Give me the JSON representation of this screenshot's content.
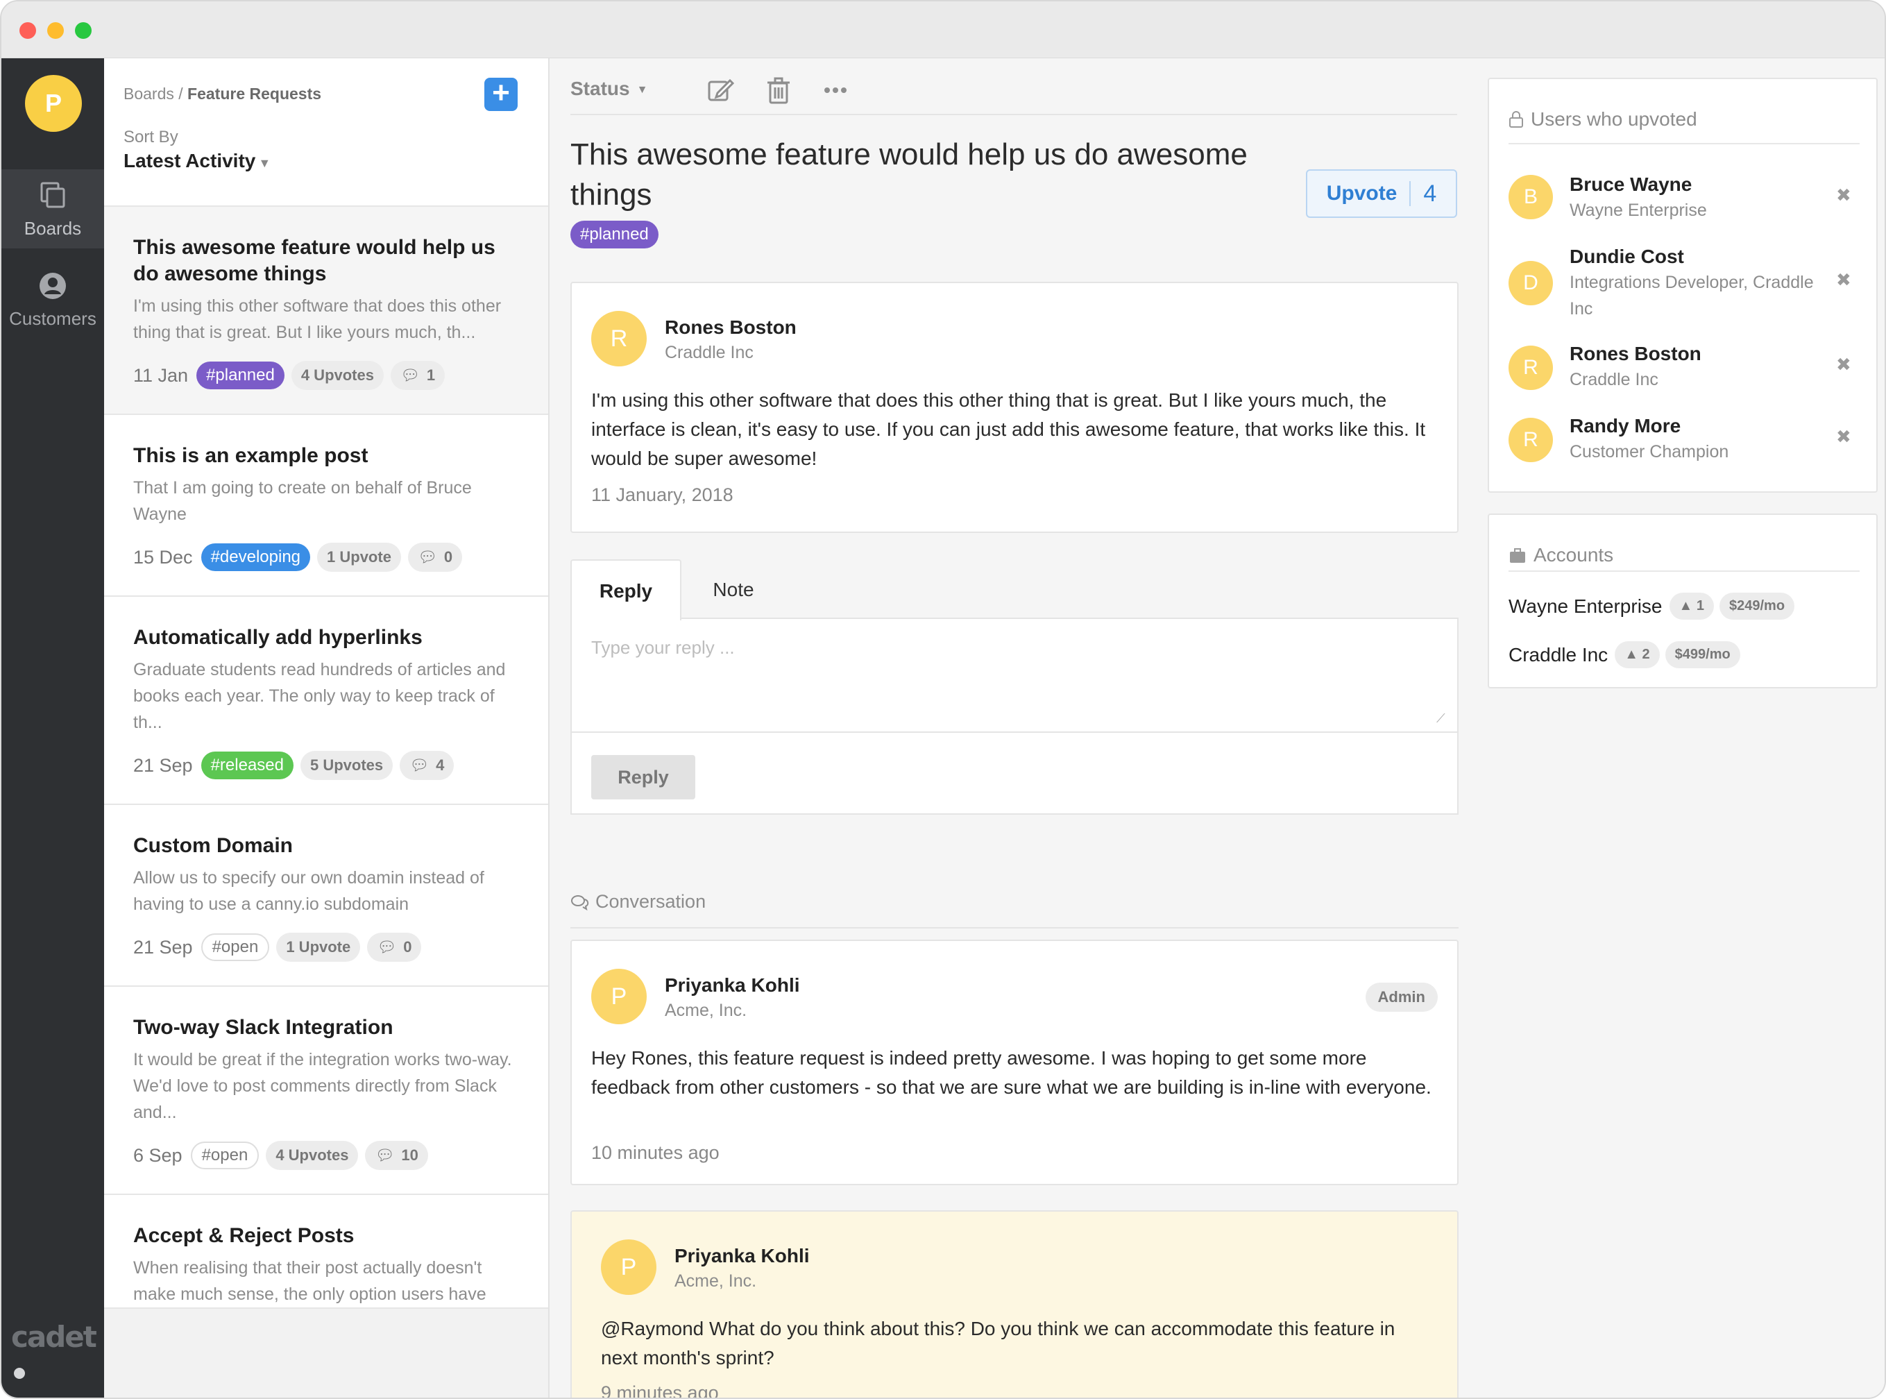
{
  "rail": {
    "avatar_letter": "P",
    "items": [
      {
        "label": "Boards"
      },
      {
        "label": "Customers"
      }
    ],
    "brand": "cadet"
  },
  "list": {
    "breadcrumb_root": "Boards /",
    "breadcrumb_current": "Feature Requests",
    "sort_label": "Sort By",
    "sort_value": "Latest Activity",
    "posts": [
      {
        "title": "This awesome feature would help us do awesome things",
        "desc": "I'm using this other software that does this other thing that is great. But I like yours much, th...",
        "date": "11 Jan",
        "tag": "#planned",
        "upvotes": "4 Upvotes",
        "comments": "1"
      },
      {
        "title": "This is an example post",
        "desc": "That I am going to create on behalf of Bruce Wayne",
        "date": "15 Dec",
        "tag": "#developing",
        "upvotes": "1 Upvote",
        "comments": "0"
      },
      {
        "title": "Automatically add hyperlinks",
        "desc": "Graduate students read hundreds of articles and books each year. The only way to keep track of th...",
        "date": "21 Sep",
        "tag": "#released",
        "upvotes": "5 Upvotes",
        "comments": "4"
      },
      {
        "title": "Custom Domain",
        "desc": "Allow us to specify our own doamin instead of having to use a canny.io subdomain",
        "date": "21 Sep",
        "tag": "#open",
        "upvotes": "1 Upvote",
        "comments": "0"
      },
      {
        "title": "Two-way Slack Integration",
        "desc": "It would be great if the integration works two-way. We'd love to post comments directly from Slack and...",
        "date": "6 Sep",
        "tag": "#open",
        "upvotes": "4 Upvotes",
        "comments": "10"
      },
      {
        "title": "Accept & Reject Posts",
        "desc": "When realising that their post actually doesn't make much sense, the only option users have",
        "date": "",
        "tag": "",
        "upvotes": "",
        "comments": ""
      }
    ]
  },
  "main": {
    "status_label": "Status",
    "title": "This awesome feature would help us do awesome things",
    "tag": "#planned",
    "upvote_label": "Upvote",
    "upvote_count": "4",
    "original_post": {
      "avatar": "R",
      "name": "Rones Boston",
      "company": "Craddle Inc",
      "body": "I'm using this other software that does this other thing that is great. But I like yours much, the interface is clean, it's easy to use. If you can just add this awesome feature, that works like this. It would be super awesome!",
      "date": "11 January, 2018"
    },
    "tabs": {
      "reply": "Reply",
      "note": "Note"
    },
    "reply_placeholder": "Type your reply ...",
    "reply_button": "Reply",
    "conversation_label": "Conversation",
    "comments": [
      {
        "avatar": "P",
        "name": "Priyanka Kohli",
        "company": "Acme, Inc.",
        "badge": "Admin",
        "body": "Hey Rones, this feature request is indeed pretty awesome. I was hoping to get some more feedback from other customers - so that we are sure what we are building is in-line with everyone.",
        "time": "10 minutes ago"
      },
      {
        "avatar": "P",
        "name": "Priyanka Kohli",
        "company": "Acme, Inc.",
        "body": "@Raymond What do you think about this? Do you think we can accommodate this feature in next month's sprint?",
        "time": "9 minutes ago"
      }
    ]
  },
  "right": {
    "upvoters_title": "Users who upvoted",
    "upvoters": [
      {
        "avatar": "B",
        "name": "Bruce Wayne",
        "sub": "Wayne Enterprise"
      },
      {
        "avatar": "D",
        "name": "Dundie Cost",
        "sub": "Integrations Developer, Craddle Inc"
      },
      {
        "avatar": "R",
        "name": "Rones Boston",
        "sub": "Craddle Inc"
      },
      {
        "avatar": "R",
        "name": "Randy More",
        "sub": "Customer Champion"
      }
    ],
    "accounts_title": "Accounts",
    "accounts": [
      {
        "name": "Wayne Enterprise",
        "count": "1",
        "mrr": "$249/mo"
      },
      {
        "name": "Craddle Inc",
        "count": "2",
        "mrr": "$499/mo"
      }
    ]
  },
  "colors": {
    "accent_blue": "#3a8ee6",
    "planned": "#7b5cc8",
    "developing": "#3a8ee6",
    "released": "#5cc752",
    "avatar_yellow": "#fbd66a",
    "note_bg": "#fdf7e1"
  }
}
